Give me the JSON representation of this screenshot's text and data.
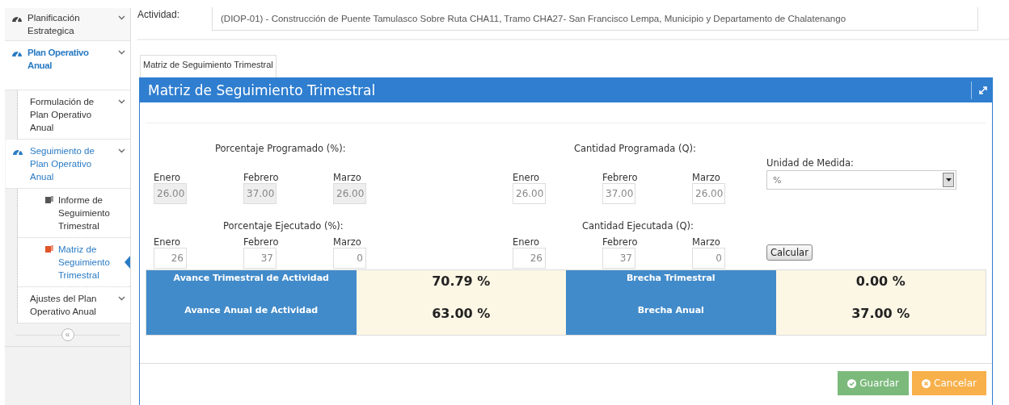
{
  "sidebar": {
    "items": [
      {
        "label": "Planificación Estrategica",
        "kind": "module",
        "expanded": false,
        "selected": false
      },
      {
        "label": "Plan Operativo Anual",
        "kind": "module",
        "expanded": true,
        "selected": false,
        "children": [
          {
            "label": "Formulación de Plan Operativo Anual",
            "kind": "group",
            "expanded": false,
            "selected": false
          },
          {
            "label": "Seguimiento de Plan Operativo Anual",
            "kind": "group",
            "expanded": true,
            "selected": false,
            "children": [
              {
                "label": "Informe de Seguimiento Trimestral",
                "kind": "page",
                "selected": false
              },
              {
                "label": "Matriz de Seguimiento Trimestral",
                "kind": "page",
                "selected": true
              }
            ]
          },
          {
            "label": "Ajustes del Plan Operativo Anual",
            "kind": "group",
            "expanded": false,
            "selected": false
          }
        ]
      }
    ],
    "collapse_button": "«"
  },
  "activity": {
    "label": "Actividad:",
    "value": "(DIOP-01) - Construcción de Puente Tamulasco Sobre Ruta CHA11, Tramo CHA27- San Francisco Lempa, Municipio y Departamento de Chalatenango"
  },
  "tabs": [
    {
      "label": "Matriz de Seguimiento Trimestral",
      "selected": true
    }
  ],
  "panel": {
    "title": "Matriz de Seguimiento Trimestral",
    "sections": [
      {
        "groups": [
          {
            "heading": "Porcentaje Programado (%):",
            "months": [
              {
                "label": "Enero",
                "value": "26.00",
                "disabled": true
              },
              {
                "label": "Febrero",
                "value": "37.00",
                "disabled": true
              },
              {
                "label": "Marzo",
                "value": "26.00",
                "disabled": true
              }
            ]
          },
          {
            "heading": "Cantidad Programada (Q):",
            "months": [
              {
                "label": "Enero",
                "value": "26.00",
                "disabled": false
              },
              {
                "label": "Febrero",
                "value": "37.00",
                "disabled": false
              },
              {
                "label": "Marzo",
                "value": "26.00",
                "disabled": false
              }
            ]
          }
        ],
        "extra": {
          "kind": "select",
          "label": "Unidad de Medida:",
          "value": "%"
        }
      },
      {
        "groups": [
          {
            "heading": "Porcentaje Ejecutado (%):",
            "months": [
              {
                "label": "Enero",
                "value": "26",
                "disabled": false
              },
              {
                "label": "Febrero",
                "value": "37",
                "disabled": false
              },
              {
                "label": "Marzo",
                "value": "0",
                "disabled": false
              }
            ]
          },
          {
            "heading": "Cantidad Ejecutada (Q):",
            "months": [
              {
                "label": "Enero",
                "value": "26",
                "disabled": false
              },
              {
                "label": "Febrero",
                "value": "37",
                "disabled": false
              },
              {
                "label": "Marzo",
                "value": "0",
                "disabled": false
              }
            ]
          }
        ],
        "extra": {
          "kind": "button",
          "label": "Calcular"
        }
      }
    ],
    "summary": [
      {
        "label": "Avance Trimestral de Actividad",
        "value": "70.79 %",
        "gap_label": "Brecha Trimestral",
        "gap_value": "0.00 %"
      },
      {
        "label": "Avance Anual de Actividad",
        "value": "63.00 %",
        "gap_label": "Brecha Anual",
        "gap_value": "37.00 %"
      }
    ],
    "buttons": [
      {
        "label": "Guardar",
        "kind": "save"
      },
      {
        "label": "Cancelar",
        "kind": "cancel"
      }
    ]
  }
}
